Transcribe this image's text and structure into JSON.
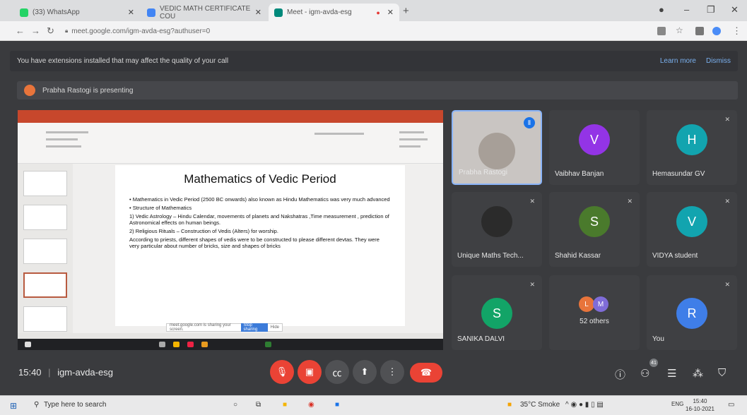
{
  "browser": {
    "tabs": [
      {
        "title": "(33) WhatsApp",
        "favicon_color": "#25d366"
      },
      {
        "title": "VEDIC MATH CERTIFICATE COU",
        "favicon_color": "#4285f4"
      },
      {
        "title": "Meet - igm-avda-esg",
        "favicon_color": "#00897b"
      }
    ],
    "new_tab": "+",
    "url": "meet.google.com/igm-avda-esg?authuser=0"
  },
  "banner": {
    "text": "You have extensions installed that may affect the quality of your call",
    "learn_more": "Learn more",
    "dismiss": "Dismiss"
  },
  "presenting": "Prabha Rastogi is presenting",
  "slide": {
    "title": "Mathematics of Vedic Period",
    "lines": [
      "• Mathematics in Vedic Period (2500 BC onwards) also known as Hindu Mathematics was very much advanced",
      "• Structure of Mathematics",
      "1) Vedic Astrology – Hindu Calendar, movements of planets and Nakshatras ,Time measurement , prediction of Astronomical effects on human beings.",
      "2) Religious Rituals – Construction of Vedis (Alters) for worship.",
      "According to priests, different shapes of vedis were to be constructed to please different devtas. They were very particular about number of bricks, size and shapes of bricks"
    ],
    "sharing_text": "meet.google.com is sharing your screen.",
    "stop_sharing": "Stop sharing",
    "hide": "Hide"
  },
  "tiles": [
    {
      "name": "Prabha Rastogi",
      "initial": "",
      "color": "",
      "speaking": true
    },
    {
      "name": "Vaibhav Banjan",
      "initial": "V",
      "color": "#9334e6"
    },
    {
      "name": "Hemasundar GV",
      "initial": "H",
      "color": "#12a4af"
    },
    {
      "name": "Unique Maths Tech...",
      "initial": "",
      "color": "#2b2b2b"
    },
    {
      "name": "Shahid Kassar",
      "initial": "S",
      "color": "#4a7a2c"
    },
    {
      "name": "VIDYA student",
      "initial": "V",
      "color": "#12a4af"
    },
    {
      "name": "SANIKA DALVI",
      "initial": "S",
      "color": "#12a467"
    },
    {
      "name": "52 others",
      "initial": "",
      "color": ""
    },
    {
      "name": "You",
      "initial": "R",
      "color": "#3f7ee8"
    }
  ],
  "others_avatars": [
    {
      "initial": "L",
      "color": "#e8743b"
    },
    {
      "initial": "M",
      "color": "#7f6cd8"
    }
  ],
  "bottom": {
    "time": "15:40",
    "meeting_code": "igm-avda-esg",
    "participants_count": "41"
  },
  "windows": {
    "search_placeholder": "Type here to search",
    "weather": "35°C Smoke",
    "lang": "ENG",
    "time": "15:40",
    "date": "16-10-2021"
  }
}
